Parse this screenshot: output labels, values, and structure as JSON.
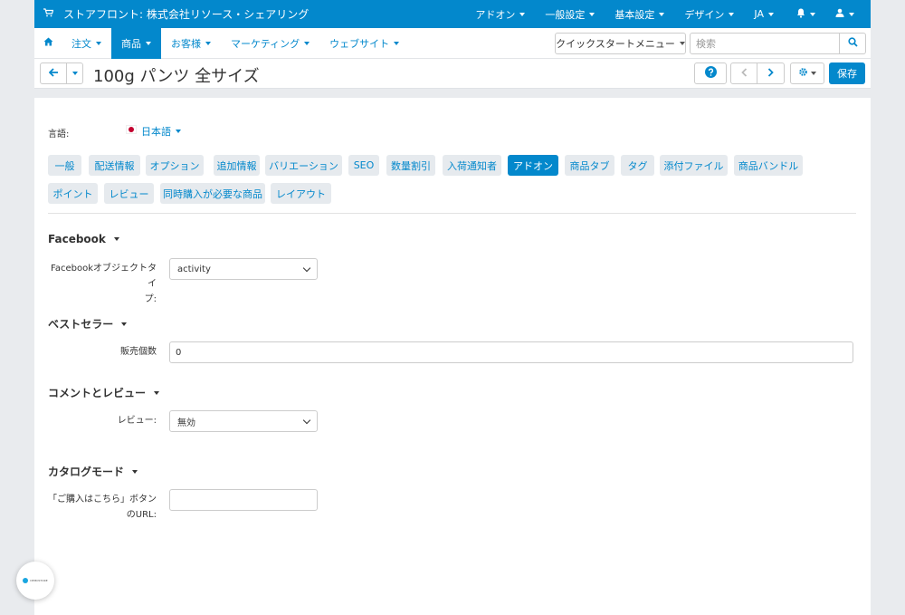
{
  "topbar": {
    "store_name": "ストアフロント: 株式会社リソース・シェアリング",
    "items": [
      {
        "label": "アドオン"
      },
      {
        "label": "一般設定"
      },
      {
        "label": "基本設定"
      },
      {
        "label": "デザイン"
      },
      {
        "label": "JA"
      }
    ]
  },
  "nav": {
    "items": [
      {
        "label": "注文"
      },
      {
        "label": "商品"
      },
      {
        "label": "お客様"
      },
      {
        "label": "マーケティング"
      },
      {
        "label": "ウェブサイト"
      }
    ],
    "quickstart_label": "クイックスタートメニュー",
    "search_placeholder": "検索"
  },
  "titlebar": {
    "title": "100g パンツ 全サイズ",
    "save_label": "保存"
  },
  "language": {
    "label": "言語:",
    "value": "日本語"
  },
  "tabs": [
    "一般",
    "配送情報",
    "オプション",
    "追加情報",
    "バリエーション",
    "SEO",
    "数量割引",
    "入荷通知者",
    "アドオン",
    "商品タブ",
    "タグ",
    "添付ファイル",
    "商品バンドル",
    "ポイント",
    "レビュー",
    "同時購入が必要な商品",
    "レイアウト"
  ],
  "active_tab": "アドオン",
  "sections": {
    "facebook": {
      "title": "Facebook",
      "field_label": "Facebookオブジェクトタイプ:",
      "field_label_line1": "Facebookオブジェクトタイ",
      "field_label_line2": "プ:",
      "value": "activity"
    },
    "bestseller": {
      "title": "ベストセラー",
      "field_label": "販売個数",
      "value": "0"
    },
    "reviews": {
      "title": "コメントとレビュー",
      "field_label": "レビュー:",
      "value": "無効"
    },
    "catalog": {
      "title": "カタログモード",
      "field_label_line1": "「ご購入はこちら」ボタン",
      "field_label_line2": "のURL:",
      "value": ""
    }
  },
  "badge": {
    "text": "DEMOSTORE"
  },
  "colors": {
    "primary": "#0388cc",
    "background": "#e9ebee",
    "tab_bg": "#e6eaee"
  }
}
